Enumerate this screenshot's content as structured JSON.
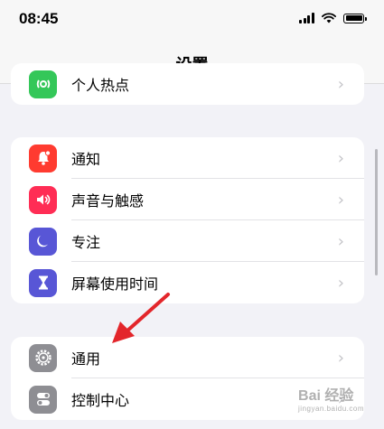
{
  "status_bar": {
    "time": "08:45"
  },
  "nav": {
    "title": "设置"
  },
  "groups": [
    {
      "items": [
        {
          "label": "个人热点",
          "icon": "hotspot-icon",
          "color": "#34c759"
        }
      ]
    },
    {
      "items": [
        {
          "label": "通知",
          "icon": "notification-bell-icon",
          "color": "#ff3b30"
        },
        {
          "label": "声音与触感",
          "icon": "speaker-icon",
          "color": "#ff2d55"
        },
        {
          "label": "专注",
          "icon": "moon-icon",
          "color": "#5856d6"
        },
        {
          "label": "屏幕使用时间",
          "icon": "hourglass-icon",
          "color": "#5856d6"
        }
      ]
    },
    {
      "items": [
        {
          "label": "通用",
          "icon": "gear-icon",
          "color": "#8e8e93"
        },
        {
          "label": "控制中心",
          "icon": "toggle-icon",
          "color": "#8e8e93"
        }
      ]
    }
  ],
  "chevron": "›",
  "watermark": {
    "text": "Bai 经验",
    "sub": "jingyan.baidu.com"
  },
  "annotation": {
    "arrow_color": "#e3262b"
  }
}
